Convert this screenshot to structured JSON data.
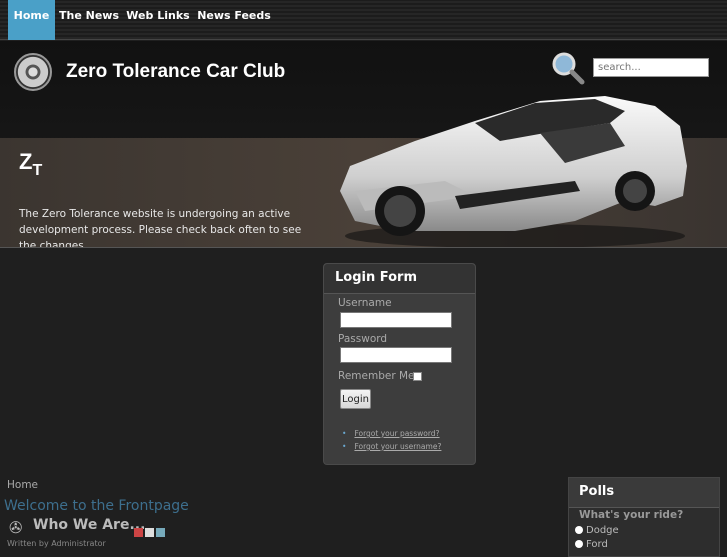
{
  "nav": {
    "items": [
      {
        "label": "Home",
        "active": true
      },
      {
        "label": "The News",
        "active": false
      },
      {
        "label": "Web Links",
        "active": false
      },
      {
        "label": "News Feeds",
        "active": false
      }
    ]
  },
  "header": {
    "site_title": "Zero Tolerance Car Club",
    "monogram_main": "Z",
    "monogram_sub": "T",
    "intro_text": "The Zero Tolerance website is undergoing an active development process. Please check back  often to see the changes.",
    "search_placeholder": "search..."
  },
  "login": {
    "title": "Login Form",
    "username_label": "Username",
    "password_label": "Password",
    "remember_label": "Remember Me",
    "button_label": "Login",
    "forgot_password": "Forgot your password?",
    "forgot_username": "Forgot your username?"
  },
  "content": {
    "breadcrumb": "Home",
    "front_title": "Welcome to the Frontpage",
    "article_title": "Who We Are...",
    "written_by": "Written by Administrator"
  },
  "polls": {
    "title": "Polls",
    "question": "What's your ride?",
    "options": [
      "Dodge",
      "Ford"
    ]
  },
  "colors": {
    "accent": "#4aa0c8",
    "link_title": "#3d6f8e"
  }
}
